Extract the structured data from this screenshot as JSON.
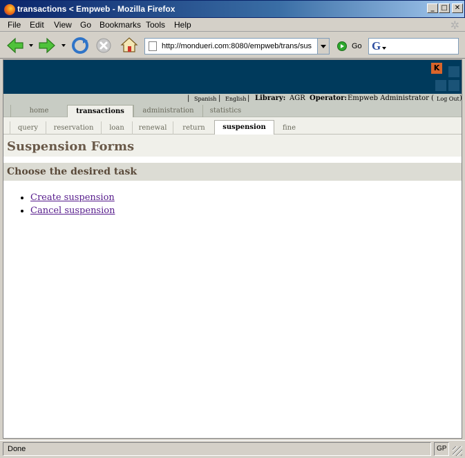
{
  "window": {
    "title": "transactions < Empweb - Mozilla Firefox",
    "btn_min": "_",
    "btn_max": "□",
    "btn_close": "✕"
  },
  "menu": [
    "File",
    "Edit",
    "View",
    "Go",
    "Bookmarks",
    "Tools",
    "Help"
  ],
  "toolbar": {
    "url": "http://mondueri.com:8080/empweb/trans/sus",
    "go_label": "Go",
    "search_glyph": "G"
  },
  "header": {
    "logo_letter": "K",
    "lang_spanish": "Spanish",
    "lang_english": "English",
    "library_label": "Library:",
    "library_value": "AGR",
    "operator_label": "Operator:",
    "operator_value": "Empweb Administrator",
    "logout": "Log Out"
  },
  "main_tabs": [
    {
      "label": "home",
      "active": false
    },
    {
      "label": "transactions",
      "active": true
    },
    {
      "label": "administration",
      "active": false
    },
    {
      "label": "statistics",
      "active": false
    }
  ],
  "sub_tabs": [
    {
      "label": "query",
      "active": false
    },
    {
      "label": "reservation",
      "active": false
    },
    {
      "label": "loan",
      "active": false
    },
    {
      "label": "renewal",
      "active": false
    },
    {
      "label": "return",
      "active": false
    },
    {
      "label": "suspension",
      "active": true
    },
    {
      "label": "fine",
      "active": false
    }
  ],
  "page": {
    "title": "Suspension Forms",
    "section_title": "Choose the desired task",
    "tasks": [
      "Create suspension",
      "Cancel suspension"
    ]
  },
  "status": {
    "text": "Done",
    "gp": "GP"
  },
  "colors": {
    "banner": "#003a5c",
    "logo_accent": "#d9642a",
    "link_visited": "#551a8b"
  }
}
